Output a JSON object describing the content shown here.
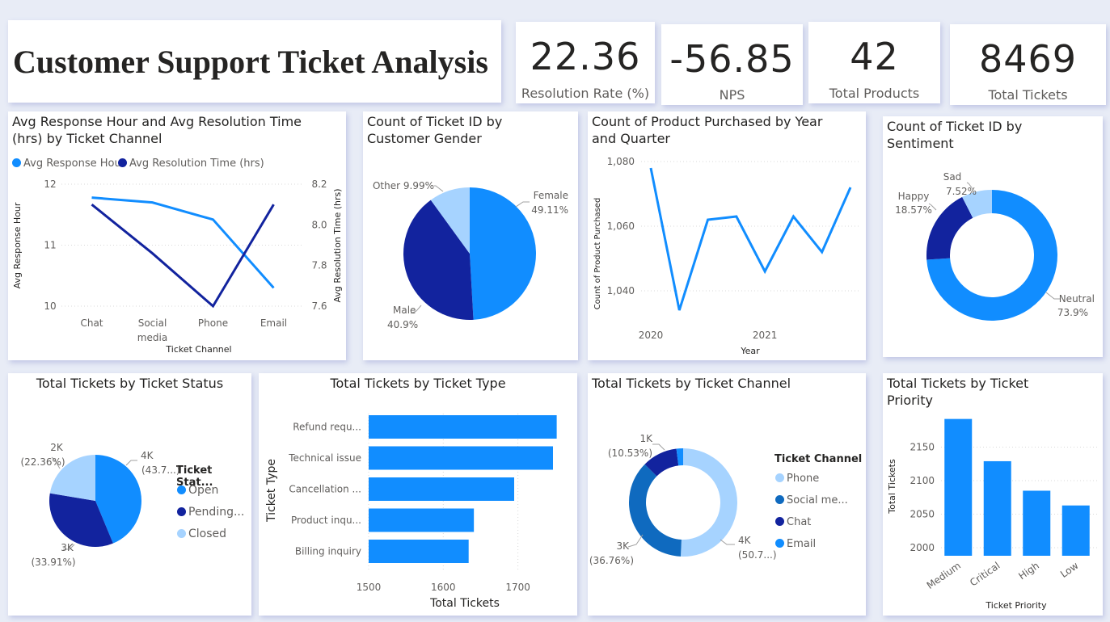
{
  "colors": {
    "blue": "#118dff",
    "navy": "#12239e",
    "lightblue": "#a6d3ff",
    "midblue": "#0f6abf",
    "grid": "#d9d9d9"
  },
  "header": {
    "title": "Customer Support Ticket Analysis"
  },
  "kpis": [
    {
      "value": "22.36",
      "label": "Resolution Rate (%)"
    },
    {
      "value": "-56.85",
      "label": "NPS"
    },
    {
      "value": "42",
      "label": "Total Products"
    },
    {
      "value": "8469",
      "label": "Total Tickets"
    }
  ],
  "chart_data": [
    {
      "type": "line",
      "title": "Avg Response Hour and Avg Resolution Time (hrs) by Ticket Channel",
      "categories": [
        "Chat",
        "Social media",
        "Phone",
        "Email"
      ],
      "xlabel": "Ticket Channel",
      "ylabel": "Avg Response Hour",
      "y2label": "Avg Resolution Time (hrs)",
      "ylim": [
        10,
        12
      ],
      "yticks": [
        "12",
        "11",
        "10"
      ],
      "y2lim": [
        7.6,
        8.2
      ],
      "y2ticks": [
        "8.2",
        "8.0",
        "7.8",
        "7.6"
      ],
      "legend": "top-left",
      "series": [
        {
          "name": "Avg Response Hour",
          "axis": "left",
          "color": "#118dff",
          "values": [
            11.78,
            11.7,
            11.42,
            10.3
          ]
        },
        {
          "name": "Avg Resolution Time (hrs)",
          "axis": "right",
          "color": "#12239e",
          "values": [
            8.1,
            7.86,
            7.6,
            8.1
          ]
        }
      ]
    },
    {
      "type": "pie",
      "title": "Count of Ticket ID by Customer Gender",
      "slices": [
        {
          "label": "Female",
          "pct_text": "49.11%",
          "value": 49.11,
          "color": "#118dff"
        },
        {
          "label": "Male",
          "pct_text": "40.9%",
          "value": 40.9,
          "color": "#12239e"
        },
        {
          "label": "Other",
          "pct_text": "9.99%",
          "value": 9.99,
          "color": "#a6d3ff"
        }
      ]
    },
    {
      "type": "line",
      "title": "Count of Product Purchased by Year and Quarter",
      "xlabel": "Year",
      "ylabel": "Count of Product Purchased",
      "xticks": [
        "2020",
        "2021"
      ],
      "yticks": [
        "1,080",
        "1,060",
        "1,040"
      ],
      "ylim": [
        1030,
        1083
      ],
      "series": [
        {
          "name": "Count of Product Purchased",
          "color": "#118dff",
          "x": [
            "2020 Q1",
            "2020 Q2",
            "2020 Q3",
            "2020 Q4",
            "2021 Q1",
            "2021 Q2",
            "2021 Q3",
            "2021 Q4"
          ],
          "values": [
            1078,
            1034,
            1062,
            1063,
            1046,
            1063,
            1052,
            1072
          ]
        }
      ]
    },
    {
      "type": "pie",
      "donut": true,
      "title": "Count of Ticket ID by Sentiment",
      "slices": [
        {
          "label": "Neutral",
          "pct_text": "73.9%",
          "value": 73.9,
          "color": "#118dff"
        },
        {
          "label": "Happy",
          "pct_text": "18.57%",
          "value": 18.57,
          "color": "#12239e"
        },
        {
          "label": "Sad",
          "pct_text": "7.52%",
          "value": 7.52,
          "color": "#a6d3ff"
        }
      ]
    },
    {
      "type": "pie",
      "title": "Total Tickets by Ticket Status",
      "legend_title": "Ticket Stat...",
      "slices": [
        {
          "label": "Open",
          "legend": "Open",
          "val_text": "4K",
          "pct_text": "(43.7...)",
          "value": 43.73,
          "color": "#118dff"
        },
        {
          "label": "Pending Customer Response",
          "legend": "Pending...",
          "val_text": "3K",
          "pct_text": "(33.91%)",
          "value": 33.91,
          "color": "#12239e"
        },
        {
          "label": "Closed",
          "legend": "Closed",
          "val_text": "2K",
          "pct_text": "(22.36%)",
          "value": 22.36,
          "color": "#a6d3ff"
        }
      ]
    },
    {
      "type": "bar",
      "orientation": "horizontal",
      "title": "Total Tickets by Ticket Type",
      "xlabel": "Total Tickets",
      "ylabel": "Ticket Type",
      "categories": [
        "Refund requ...",
        "Technical issue",
        "Cancellation ...",
        "Product inqu...",
        "Billing inquiry"
      ],
      "values": [
        1752,
        1747,
        1695,
        1641,
        1634
      ],
      "xlim": [
        1500,
        1760
      ],
      "xticks": [
        "1500",
        "1600",
        "1700"
      ],
      "color": "#118dff"
    },
    {
      "type": "pie",
      "donut": true,
      "title": "Total Tickets by Ticket Channel",
      "legend_title": "Ticket Channel",
      "slices": [
        {
          "label": "Phone",
          "legend": "Phone",
          "val_text": "4K",
          "pct_text": "(50.7...)",
          "value": 50.71,
          "color": "#a6d3ff"
        },
        {
          "label": "Social media",
          "legend": "Social me...",
          "val_text": "3K",
          "pct_text": "(36.76%)",
          "value": 36.76,
          "color": "#0f6abf"
        },
        {
          "label": "Chat",
          "legend": "Chat",
          "val_text": "1K",
          "pct_text": "(10.53%)",
          "value": 10.53,
          "color": "#12239e"
        },
        {
          "label": "Email",
          "legend": "Email",
          "val_text": "",
          "pct_text": "",
          "value": 2.0,
          "color": "#118dff"
        }
      ]
    },
    {
      "type": "bar",
      "title": "Total Tickets by Ticket Priority",
      "xlabel": "Ticket Priority",
      "ylabel": "Total Tickets",
      "categories": [
        "Medium",
        "Critical",
        "High",
        "Low"
      ],
      "values": [
        2192,
        2129,
        2085,
        2063
      ],
      "ylim": [
        1988,
        2200
      ],
      "yticks": [
        "2150",
        "2100",
        "2050",
        "2000"
      ],
      "color": "#118dff"
    }
  ]
}
